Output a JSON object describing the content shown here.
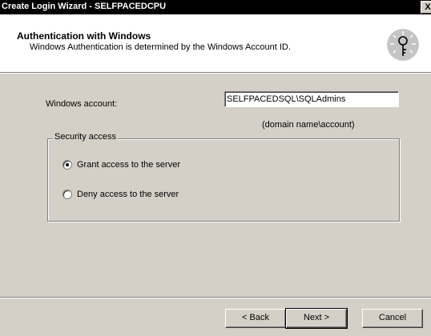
{
  "window": {
    "title": "Create Login Wizard - SELFPACEDCPU",
    "close_label": "X"
  },
  "header": {
    "title": "Authentication with Windows",
    "subtitle": "Windows Authentication is determined by the Windows Account ID.",
    "icon": "key-icon"
  },
  "form": {
    "account_label": "Windows account:",
    "account_value": "SELFPACEDSQL\\SQLAdmins",
    "account_hint": "(domain name\\account)"
  },
  "security": {
    "legend": "Security access",
    "options": [
      {
        "label": "Grant access to the server",
        "checked": true
      },
      {
        "label": "Deny access to the server",
        "checked": false
      }
    ]
  },
  "buttons": {
    "back": "< Back",
    "next": "Next >",
    "cancel": "Cancel"
  }
}
